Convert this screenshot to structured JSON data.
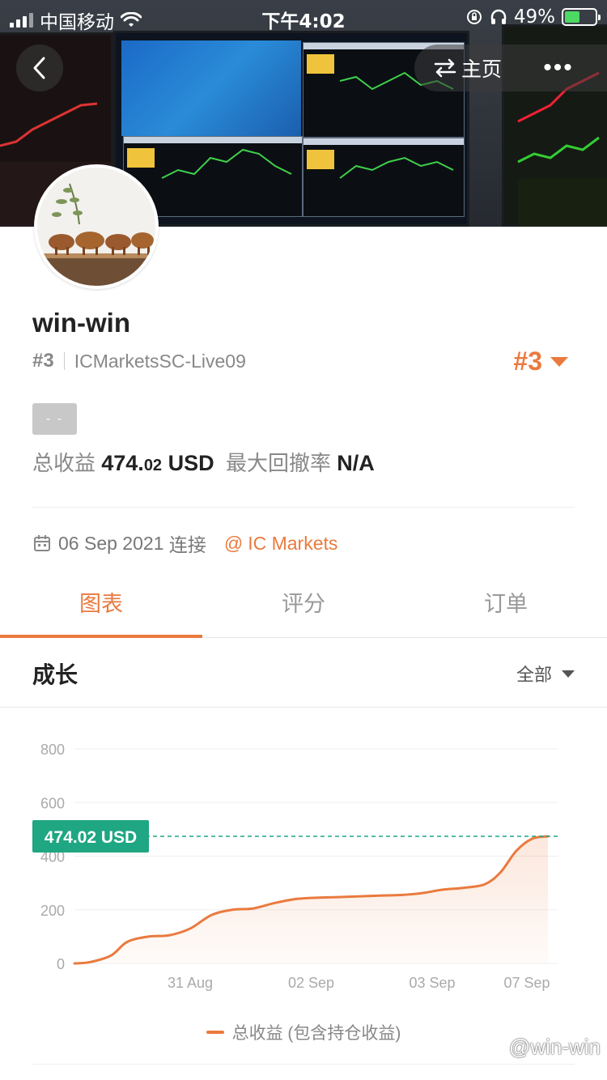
{
  "status_bar": {
    "carrier": "中国移动",
    "time": "下午4:02",
    "battery": "49%",
    "battery_level": 0.49
  },
  "header": {
    "home_label": "主页",
    "more_label": "•••"
  },
  "profile": {
    "username": "win-win",
    "rank": "#3",
    "server": "ICMarketsSC-Live09",
    "rank_badge": "#3",
    "tag": "- -",
    "total_profit_label": "总收益",
    "total_profit_int": "474.",
    "total_profit_dec": "02",
    "total_profit_unit": "USD",
    "max_drawdown_label": "最大回撤率",
    "max_drawdown_value": "N/A",
    "connected_date": "06 Sep 2021",
    "connected_label": "连接",
    "broker": "IC Markets",
    "broker_prefix": "@"
  },
  "tabs": [
    {
      "label": "图表",
      "active": true
    },
    {
      "label": "评分",
      "active": false
    },
    {
      "label": "订单",
      "active": false
    }
  ],
  "section": {
    "title": "成长",
    "filter": "全部"
  },
  "chart_data": {
    "type": "area",
    "y_ticks": [
      "800",
      "600",
      "400",
      "200",
      "0"
    ],
    "ylim": [
      0,
      800
    ],
    "x_tick_labels": [
      "31 Aug",
      "02 Sep",
      "03 Sep",
      "07 Sep"
    ],
    "x_tick_positions": [
      2.2,
      4.5,
      6.8,
      8.6
    ],
    "xlim": [
      0,
      9.2
    ],
    "series": [
      {
        "name": "总收益 (包含持仓收益)",
        "x": [
          0,
          0.3,
          0.7,
          1.0,
          1.4,
          1.8,
          2.2,
          2.6,
          3.0,
          3.4,
          3.8,
          4.2,
          4.6,
          5.0,
          5.4,
          5.8,
          6.2,
          6.6,
          7.0,
          7.4,
          7.8,
          8.1,
          8.4,
          8.7,
          9.0
        ],
        "y": [
          0,
          5,
          30,
          80,
          100,
          105,
          130,
          180,
          200,
          205,
          225,
          240,
          245,
          247,
          250,
          253,
          255,
          262,
          275,
          282,
          295,
          340,
          420,
          465,
          474.02
        ]
      }
    ],
    "current_value_label": "474.02 USD",
    "current_value": 474.02,
    "accent": "#ea7a3e",
    "marker_color": "#1fa683"
  },
  "legend": {
    "label": "总收益 (包含持仓收益)"
  },
  "watermark": "@win-win"
}
